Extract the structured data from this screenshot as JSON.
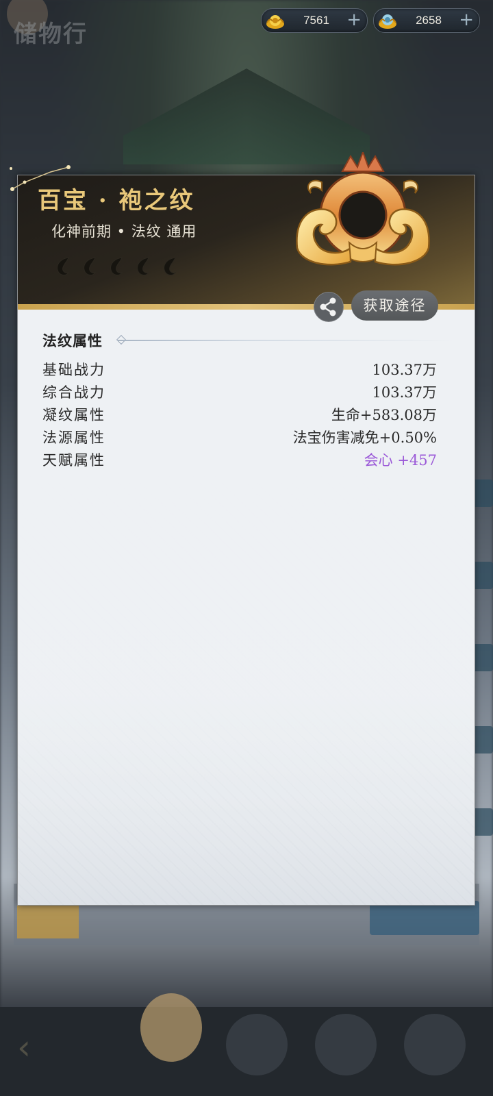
{
  "currencies": [
    {
      "icon": "gold-ingot-icon",
      "value": "7561",
      "add": "+"
    },
    {
      "icon": "jade-pouch-icon",
      "value": "2658",
      "add": "+"
    }
  ],
  "background": {
    "title": "储物行"
  },
  "item": {
    "name": "百宝 · 袍之纹",
    "subtitle": "化神前期 • 法纹 通用",
    "rank_marks": 5,
    "emblem_icon": "ornate-ring-emblem-icon"
  },
  "actions": {
    "share_icon": "share-icon",
    "obtain_label": "获取途径"
  },
  "attributes": {
    "section_title": "法纹属性",
    "rows": [
      {
        "label": "基础战力",
        "value": "103.37万"
      },
      {
        "label": "综合战力",
        "value": "103.37万"
      },
      {
        "label": "凝纹属性",
        "value": "生命+583.08万"
      },
      {
        "label": "法源属性",
        "value": "法宝伤害减免+0.50%"
      },
      {
        "label": "天赋属性",
        "value": "会心 +457"
      }
    ]
  },
  "colors": {
    "name_gold": "#e9c87a",
    "talent_purple": "#9b59d8",
    "header_dark": "#1f1c18"
  }
}
